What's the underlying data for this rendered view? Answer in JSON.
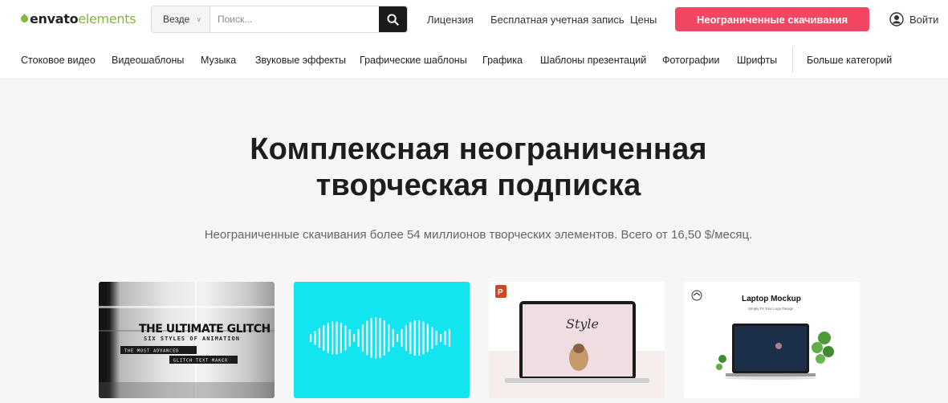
{
  "header": {
    "logo_part1": "envato",
    "logo_part2": "elements",
    "search_scope": "Везде",
    "search_placeholder": "Поиск...",
    "links": [
      "Лицензия",
      "Бесплатная учетная запись",
      "Цены"
    ],
    "cta_label": "Неограниченные скачивания",
    "login_label": "Войти"
  },
  "categories": [
    "Стоковое видео",
    "Видеошаблоны",
    "Музыка",
    "Звуковые эффекты",
    "Графические шаблоны",
    "Графика",
    "Шаблоны презентаций",
    "Фотографии",
    "Шрифты"
  ],
  "more_categories": "Больше категорий",
  "hero": {
    "title_line1": "Комплексная неограниченная",
    "title_line2": "творческая подписка",
    "subtitle": "Неограниченные скачивания более 54 миллионов творческих элементов. Всего от 16,50 $/месяц."
  },
  "cards": {
    "glitch_title": "THE ULTIMATE GLITCH",
    "glitch_sub": "SIX STYLES OF ANIMATION",
    "glitch_tag1": "THE MOST ADVANCED",
    "glitch_tag2": "GLITCH TEXT MAKER",
    "ppt_badge": "P",
    "style_word": "Style",
    "laptop_title": "Laptop Mockup",
    "laptop_sub": "Simply Fit Your Logo Design"
  },
  "colors": {
    "accent": "#f14763",
    "brand": "#82b541",
    "waveform_bg": "#12e5f0"
  }
}
